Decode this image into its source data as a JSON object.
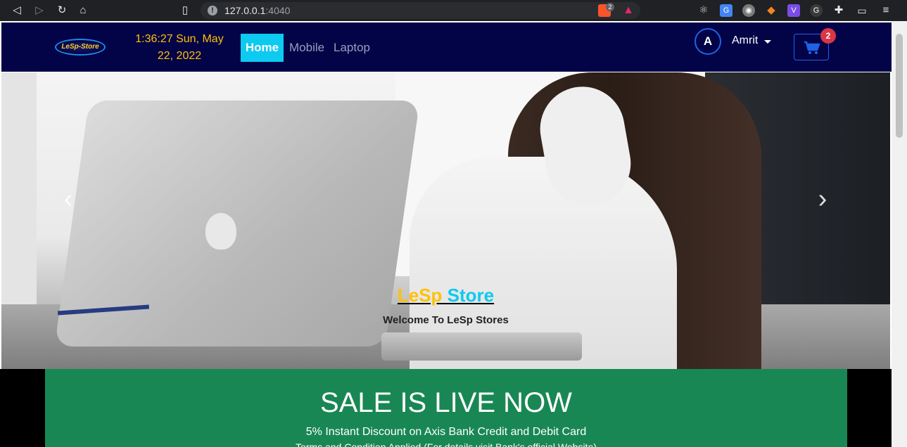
{
  "browser": {
    "url_host": "127.0.0.1",
    "url_port": ":4040",
    "extension_badge": "2"
  },
  "nav": {
    "logo_text": "LeSp-Store",
    "clock_line1": "1:36:27 Sun, May",
    "clock_line2": "22, 2022",
    "home": "Home",
    "mobile": "Mobile",
    "laptop": "Laptop",
    "avatar_letter": "A",
    "username": "Amrit",
    "cart_count": "2"
  },
  "hero": {
    "title_part1": "LeSp",
    "title_part2": " Store",
    "subtitle": "Welcome To LeSp Stores",
    "prev_glyph": "‹",
    "next_glyph": "›"
  },
  "sale": {
    "heading": "SALE IS LIVE NOW",
    "line1": "5% Instant Discount on Axis Bank Credit and Debit Card",
    "line2": "Terms and Condition Applied (For details visit Bank's official Website)"
  }
}
